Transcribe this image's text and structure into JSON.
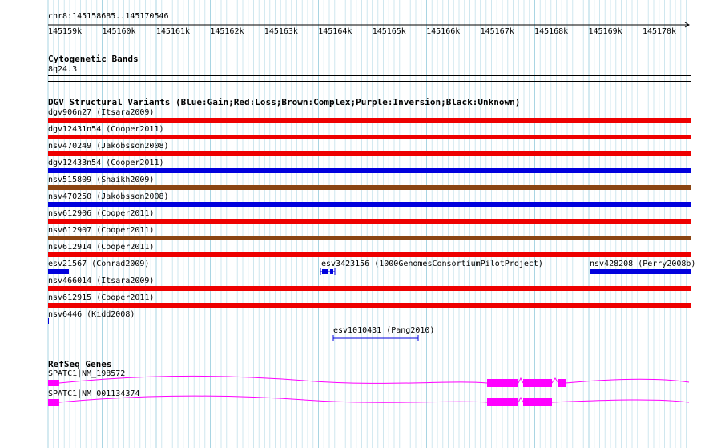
{
  "ruler": {
    "locus": "chr8:145158685..145170546",
    "ticks": [
      "145159k",
      "145160k",
      "145161k",
      "145162k",
      "145163k",
      "145164k",
      "145165k",
      "145166k",
      "145167k",
      "145168k",
      "145169k",
      "145170k"
    ]
  },
  "cytobands": {
    "title": "Cytogenetic Bands",
    "band": "8q24.3"
  },
  "dgv": {
    "title": "DGV Structural Variants (Blue:Gain;Red:Loss;Brown:Complex;Purple:Inversion;Black:Unknown)",
    "colors": {
      "gain": "#0000dd",
      "loss": "#ee0000",
      "complex": "#8b4513",
      "unknown": "#000000"
    },
    "variants": [
      {
        "label": "dgv906n27 (Itsara2009)",
        "type": "loss"
      },
      {
        "label": "dgv12431n54 (Cooper2011)",
        "type": "loss"
      },
      {
        "label": "nsv470249 (Jakobsson2008)",
        "type": "loss"
      },
      {
        "label": "dgv12433n54 (Cooper2011)",
        "type": "gain"
      },
      {
        "label": "nsv515809 (Shaikh2009)",
        "type": "complex"
      },
      {
        "label": "nsv470250 (Jakobsson2008)",
        "type": "gain"
      },
      {
        "label": "nsv612906 (Cooper2011)",
        "type": "loss"
      },
      {
        "label": "nsv612907 (Cooper2011)",
        "type": "complex"
      },
      {
        "label": "nsv612914 (Cooper2011)",
        "type": "loss"
      },
      {
        "label": "esv21567 (Conrad2009)",
        "type": "gain"
      },
      {
        "label": "esv3423156 (1000GenomesConsortiumPilotProject)",
        "type": "gain"
      },
      {
        "label": "nsv428208 (Perry2008b)",
        "type": "gain"
      },
      {
        "label": "nsv466014 (Itsara2009)",
        "type": "loss"
      },
      {
        "label": "nsv612915 (Cooper2011)",
        "type": "loss"
      },
      {
        "label": "nsv6446 (Kidd2008)",
        "type": "gain"
      },
      {
        "label": "esv1010431 (Pang2010)",
        "type": "gain"
      }
    ]
  },
  "refseq": {
    "title": "RefSeq Genes",
    "color": "#ff00ff",
    "genes": [
      {
        "label": "SPATC1|NM_198572"
      },
      {
        "label": "SPATC1|NM_001134374"
      }
    ]
  }
}
